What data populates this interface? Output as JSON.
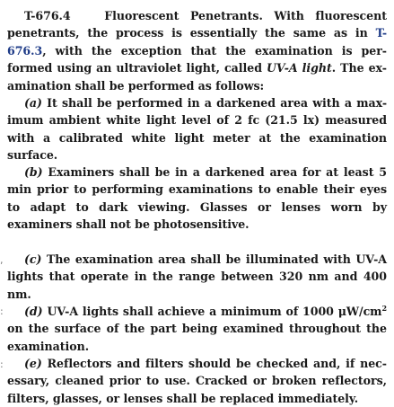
{
  "section": {
    "number": "T-676.4",
    "title": "Fluorescent Penetrants.",
    "intro_before_ref": "With fluorescent penetrants, the process is essentially the same as in ",
    "ref": "T-676.3",
    "intro_mid": ", with the exception that the examination is per-formed using an ultraviolet light, called ",
    "uva_term": "UV-A light",
    "intro_after": ". The ex-amination shall be performed as follows:"
  },
  "items": [
    {
      "label": "(a)",
      "text": "It shall be performed in a darkened area with a max-imum ambient white light level of 2 fc (21.5 lx) measured with a calibrated white light meter at the examination surface."
    },
    {
      "label": "(b)",
      "text": "Examiners shall be in a darkened area for at least 5 min prior to performing examinations to enable their eyes to adapt to dark viewing. Glasses or lenses worn by examiners shall not be photosensitive."
    },
    {
      "label": "(c)",
      "text": "The examination area shall be illuminated with UV-A lights that operate in the range between 320 nm and 400 nm."
    },
    {
      "label": "(d)",
      "text_before": "UV-A lights shall achieve a minimum of 1000 μW/cm",
      "superscript": "2",
      "text_after": " on the surface of the part being examined throughout the examination."
    },
    {
      "label": "(e)",
      "text": "Reflectors and filters should be checked and, if nec-essary, cleaned prior to use. Cracked or broken reflectors, filters, glasses, or lenses shall be replaced immediately."
    }
  ],
  "margin_marks": [
    ",",
    ":",
    ":"
  ]
}
